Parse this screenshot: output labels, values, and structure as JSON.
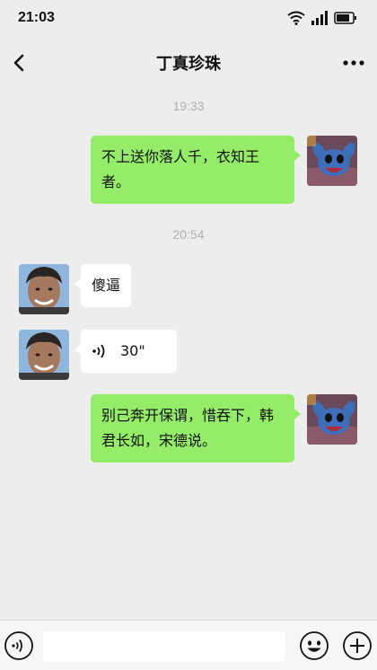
{
  "status": {
    "time": "21:03"
  },
  "nav": {
    "title": "丁真珍珠"
  },
  "messages": [
    {
      "type": "time",
      "text": "19:33"
    },
    {
      "type": "text",
      "from": "me",
      "text": "不上送你落人千，衣知王者。"
    },
    {
      "type": "time",
      "text": "20:54"
    },
    {
      "type": "text",
      "from": "other",
      "text": "傻逼"
    },
    {
      "type": "voice",
      "from": "other",
      "duration": "30\""
    },
    {
      "type": "text",
      "from": "me",
      "text": "别己奔开保谓，惜吞下，韩君长如，宋德说。"
    }
  ],
  "input": {
    "value": "",
    "placeholder": ""
  },
  "icons": {
    "back": "chevron-left-icon",
    "more": "more-dots-icon",
    "voice_toggle": "voice-icon",
    "emoji": "emoji-icon",
    "add": "plus-icon"
  },
  "colors": {
    "my_bubble": "#95ec69",
    "other_bubble": "#ffffff",
    "background": "#ededed"
  }
}
